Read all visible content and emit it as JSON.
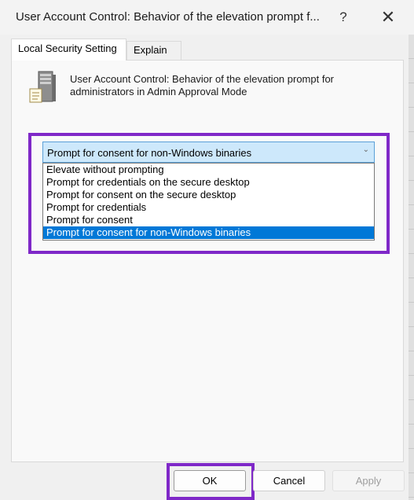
{
  "window": {
    "title": "User Account Control: Behavior of the elevation prompt f...",
    "help_glyph": "?",
    "close_glyph": "✕"
  },
  "tabs": [
    {
      "label": "Local Security Setting",
      "active": true
    },
    {
      "label": "Explain",
      "active": false
    }
  ],
  "policy": {
    "icon": "server-policy-icon",
    "line1": "User Account Control: Behavior of the elevation prompt for",
    "line2": "administrators in Admin Approval Mode"
  },
  "dropdown": {
    "selected": "Prompt for consent for non-Windows binaries",
    "arrow_glyph": "⌄",
    "options": [
      "Elevate without prompting",
      "Prompt for credentials on the secure desktop",
      "Prompt for consent on the secure desktop",
      "Prompt for credentials",
      "Prompt for consent",
      "Prompt for consent for non-Windows binaries"
    ],
    "selected_index": 5
  },
  "buttons": {
    "ok": "OK",
    "cancel": "Cancel",
    "apply": "Apply"
  },
  "colors": {
    "highlight": "#7f28c8",
    "selection": "#0078d7"
  }
}
